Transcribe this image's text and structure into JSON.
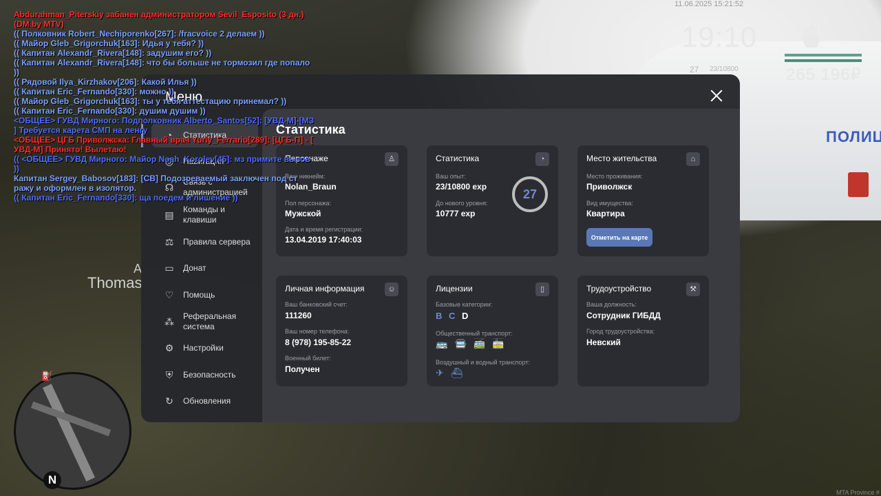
{
  "hud": {
    "datetime": "11.06.2025 15:21:52",
    "time": "19:10",
    "level": "27",
    "exp": "23/10800",
    "money": "265 196₽",
    "mta": "MTA Province #"
  },
  "background": {
    "player_tag": "A",
    "player_name": "Thomas",
    "police_text": "ПОЛИЦ"
  },
  "minimap": {
    "compass": "N"
  },
  "chat": [
    {
      "text": "Abdurahman_Piterskiy забанен администратором Sevil_Esposito (3 дн.)\n(DM by MTV)",
      "color": "#ff2a2a"
    },
    {
      "text": "(( Полковник Robert_Nechiporenko[267]: /fracvoice 2 делаем ))",
      "color": "#7aa0ff"
    },
    {
      "text": "(( Майор Gleb_Grigorchuk[163]: Идья у тебя? ))",
      "color": "#7aa0ff"
    },
    {
      "text": "(( Капитан Alexandr_Rivera[148]: задушим его? ))",
      "color": "#7aa0ff"
    },
    {
      "text": "(( Капитан Alexandr_Rivera[148]: что бы больше не тормозил где попало\n))",
      "color": "#7aa0ff"
    },
    {
      "text": "(( Рядовой Ilya_Kirzhakov[206]: Какой Илья ))",
      "color": "#7aa0ff"
    },
    {
      "text": "(( Капитан Eric_Fernando[330]: можно ))",
      "color": "#7aa0ff"
    },
    {
      "text": "(( Майор Gleb_Grigorchuk[163]: ты у тебя аттестацию принемал? ))",
      "color": "#7aa0ff"
    },
    {
      "text": "(( Капитан Eric_Fernando[330]: душим душим ))",
      "color": "#7aa0ff"
    },
    {
      "text": "<ОБЩЕЕ> ГУВД Мирного: Подполковник Alberto_Santos[52]: [УВД-М]-[МЗ\n] Требуется карета СМП на ленгу",
      "color": "#4f6bff"
    },
    {
      "text": "<ОБЩЕЕ> ЦГБ Приволжска: Главный врач Yuriy_Ferrario[289]: [ЦГБ-П] - [\nУВД-М] Принято! Вылетаю!",
      "color": "#ff2a2a"
    },
    {
      "text": "(( <ОБЩЕЕ> ГУВД Мирного: Майор Noah_Korolev[45]: мз примите вызов\n))",
      "color": "#4f6bff"
    },
    {
      "text": "Капитан Sergey_Babosov[183]: [СВ] Подозреваемый заключен под ст\nражу и оформлен в изолятор.",
      "color": "#7aa0ff"
    },
    {
      "text": "(( Капитан Eric_Fernando[330]: ща поедем и лишение ))",
      "color": "#4f6bff"
    }
  ],
  "menu": {
    "title": "Меню",
    "content_title": "Статистика",
    "sidebar": [
      {
        "label": "Статистика",
        "icon": "pie-chart-icon"
      },
      {
        "label": "Навигация",
        "icon": "compass-icon"
      },
      {
        "label": "Связь с администрацией",
        "icon": "headset-icon"
      },
      {
        "label": "Команды и клавиши",
        "icon": "document-icon"
      },
      {
        "label": "Правила сервера",
        "icon": "scales-icon"
      },
      {
        "label": "Донат",
        "icon": "wallet-icon"
      },
      {
        "label": "Помощь",
        "icon": "handshake-icon"
      },
      {
        "label": "Реферальная система",
        "icon": "referral-icon"
      },
      {
        "label": "Настройки",
        "icon": "gear-icon"
      },
      {
        "label": "Безопасность",
        "icon": "shield-icon"
      },
      {
        "label": "Обновления",
        "icon": "refresh-icon"
      }
    ],
    "cards": {
      "character": {
        "title": "Персонаже",
        "nickname_label": "Ваш никнейм:",
        "nickname": "Nolan_Braun",
        "gender_label": "Пол персонажа:",
        "gender": "Мужской",
        "reg_label": "Дата и время регистрации:",
        "reg": "13.04.2019 17:40:03"
      },
      "stats": {
        "title": "Статистика",
        "exp_label": "Ваш опыт:",
        "exp": "23/10800 exp",
        "next_label": "До нового уровня:",
        "next": "10777 exp",
        "level": "27"
      },
      "residence": {
        "title": "Место жительства",
        "place_label": "Место проживания:",
        "place": "Приволжск",
        "property_label": "Вид имущества:",
        "property": "Квартира",
        "map_button": "Отметить на карте"
      },
      "personal": {
        "title": "Личная информация",
        "bank_label": "Ваш банковский счет:",
        "bank": "111260",
        "phone_label": "Ваш номер телефона:",
        "phone": "8 (978) 195-85-22",
        "military_label": "Военный билет:",
        "military": "Получен"
      },
      "licenses": {
        "title": "Лицензии",
        "base_label": "Базовые категории:",
        "categories": [
          {
            "letter": "B",
            "color": "#6b8ccc"
          },
          {
            "letter": "C",
            "color": "#6b8ccc"
          },
          {
            "letter": "D",
            "color": "#ffffff"
          }
        ],
        "public_label": "Общественный транспорт:",
        "public_icons": [
          "bus-icon",
          "bus-icon",
          "bus-icon",
          "tram-icon"
        ],
        "air_label": "Воздушный и водный транспорт:",
        "air_icons": [
          "plane-icon",
          "boat-icon"
        ]
      },
      "job": {
        "title": "Трудоустройство",
        "position_label": "Ваша должность:",
        "position": "Сотрудник ГИБДД",
        "city_label": "Город трудоустройства:",
        "city": "Невский"
      }
    }
  }
}
